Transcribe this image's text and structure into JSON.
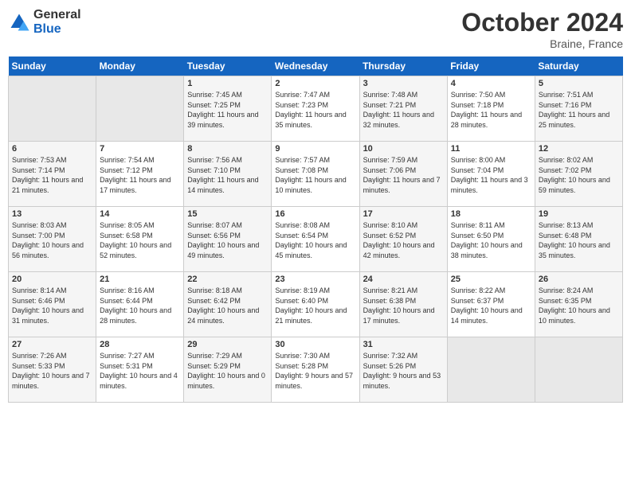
{
  "header": {
    "logo_general": "General",
    "logo_blue": "Blue",
    "title": "October 2024",
    "location": "Braine, France"
  },
  "weekdays": [
    "Sunday",
    "Monday",
    "Tuesday",
    "Wednesday",
    "Thursday",
    "Friday",
    "Saturday"
  ],
  "weeks": [
    [
      {
        "day": "",
        "empty": true
      },
      {
        "day": "",
        "empty": true
      },
      {
        "day": "1",
        "sunrise": "Sunrise: 7:45 AM",
        "sunset": "Sunset: 7:25 PM",
        "daylight": "Daylight: 11 hours and 39 minutes."
      },
      {
        "day": "2",
        "sunrise": "Sunrise: 7:47 AM",
        "sunset": "Sunset: 7:23 PM",
        "daylight": "Daylight: 11 hours and 35 minutes."
      },
      {
        "day": "3",
        "sunrise": "Sunrise: 7:48 AM",
        "sunset": "Sunset: 7:21 PM",
        "daylight": "Daylight: 11 hours and 32 minutes."
      },
      {
        "day": "4",
        "sunrise": "Sunrise: 7:50 AM",
        "sunset": "Sunset: 7:18 PM",
        "daylight": "Daylight: 11 hours and 28 minutes."
      },
      {
        "day": "5",
        "sunrise": "Sunrise: 7:51 AM",
        "sunset": "Sunset: 7:16 PM",
        "daylight": "Daylight: 11 hours and 25 minutes."
      }
    ],
    [
      {
        "day": "6",
        "sunrise": "Sunrise: 7:53 AM",
        "sunset": "Sunset: 7:14 PM",
        "daylight": "Daylight: 11 hours and 21 minutes."
      },
      {
        "day": "7",
        "sunrise": "Sunrise: 7:54 AM",
        "sunset": "Sunset: 7:12 PM",
        "daylight": "Daylight: 11 hours and 17 minutes."
      },
      {
        "day": "8",
        "sunrise": "Sunrise: 7:56 AM",
        "sunset": "Sunset: 7:10 PM",
        "daylight": "Daylight: 11 hours and 14 minutes."
      },
      {
        "day": "9",
        "sunrise": "Sunrise: 7:57 AM",
        "sunset": "Sunset: 7:08 PM",
        "daylight": "Daylight: 11 hours and 10 minutes."
      },
      {
        "day": "10",
        "sunrise": "Sunrise: 7:59 AM",
        "sunset": "Sunset: 7:06 PM",
        "daylight": "Daylight: 11 hours and 7 minutes."
      },
      {
        "day": "11",
        "sunrise": "Sunrise: 8:00 AM",
        "sunset": "Sunset: 7:04 PM",
        "daylight": "Daylight: 11 hours and 3 minutes."
      },
      {
        "day": "12",
        "sunrise": "Sunrise: 8:02 AM",
        "sunset": "Sunset: 7:02 PM",
        "daylight": "Daylight: 10 hours and 59 minutes."
      }
    ],
    [
      {
        "day": "13",
        "sunrise": "Sunrise: 8:03 AM",
        "sunset": "Sunset: 7:00 PM",
        "daylight": "Daylight: 10 hours and 56 minutes."
      },
      {
        "day": "14",
        "sunrise": "Sunrise: 8:05 AM",
        "sunset": "Sunset: 6:58 PM",
        "daylight": "Daylight: 10 hours and 52 minutes."
      },
      {
        "day": "15",
        "sunrise": "Sunrise: 8:07 AM",
        "sunset": "Sunset: 6:56 PM",
        "daylight": "Daylight: 10 hours and 49 minutes."
      },
      {
        "day": "16",
        "sunrise": "Sunrise: 8:08 AM",
        "sunset": "Sunset: 6:54 PM",
        "daylight": "Daylight: 10 hours and 45 minutes."
      },
      {
        "day": "17",
        "sunrise": "Sunrise: 8:10 AM",
        "sunset": "Sunset: 6:52 PM",
        "daylight": "Daylight: 10 hours and 42 minutes."
      },
      {
        "day": "18",
        "sunrise": "Sunrise: 8:11 AM",
        "sunset": "Sunset: 6:50 PM",
        "daylight": "Daylight: 10 hours and 38 minutes."
      },
      {
        "day": "19",
        "sunrise": "Sunrise: 8:13 AM",
        "sunset": "Sunset: 6:48 PM",
        "daylight": "Daylight: 10 hours and 35 minutes."
      }
    ],
    [
      {
        "day": "20",
        "sunrise": "Sunrise: 8:14 AM",
        "sunset": "Sunset: 6:46 PM",
        "daylight": "Daylight: 10 hours and 31 minutes."
      },
      {
        "day": "21",
        "sunrise": "Sunrise: 8:16 AM",
        "sunset": "Sunset: 6:44 PM",
        "daylight": "Daylight: 10 hours and 28 minutes."
      },
      {
        "day": "22",
        "sunrise": "Sunrise: 8:18 AM",
        "sunset": "Sunset: 6:42 PM",
        "daylight": "Daylight: 10 hours and 24 minutes."
      },
      {
        "day": "23",
        "sunrise": "Sunrise: 8:19 AM",
        "sunset": "Sunset: 6:40 PM",
        "daylight": "Daylight: 10 hours and 21 minutes."
      },
      {
        "day": "24",
        "sunrise": "Sunrise: 8:21 AM",
        "sunset": "Sunset: 6:38 PM",
        "daylight": "Daylight: 10 hours and 17 minutes."
      },
      {
        "day": "25",
        "sunrise": "Sunrise: 8:22 AM",
        "sunset": "Sunset: 6:37 PM",
        "daylight": "Daylight: 10 hours and 14 minutes."
      },
      {
        "day": "26",
        "sunrise": "Sunrise: 8:24 AM",
        "sunset": "Sunset: 6:35 PM",
        "daylight": "Daylight: 10 hours and 10 minutes."
      }
    ],
    [
      {
        "day": "27",
        "sunrise": "Sunrise: 7:26 AM",
        "sunset": "Sunset: 5:33 PM",
        "daylight": "Daylight: 10 hours and 7 minutes."
      },
      {
        "day": "28",
        "sunrise": "Sunrise: 7:27 AM",
        "sunset": "Sunset: 5:31 PM",
        "daylight": "Daylight: 10 hours and 4 minutes."
      },
      {
        "day": "29",
        "sunrise": "Sunrise: 7:29 AM",
        "sunset": "Sunset: 5:29 PM",
        "daylight": "Daylight: 10 hours and 0 minutes."
      },
      {
        "day": "30",
        "sunrise": "Sunrise: 7:30 AM",
        "sunset": "Sunset: 5:28 PM",
        "daylight": "Daylight: 9 hours and 57 minutes."
      },
      {
        "day": "31",
        "sunrise": "Sunrise: 7:32 AM",
        "sunset": "Sunset: 5:26 PM",
        "daylight": "Daylight: 9 hours and 53 minutes."
      },
      {
        "day": "",
        "empty": true
      },
      {
        "day": "",
        "empty": true
      }
    ]
  ]
}
